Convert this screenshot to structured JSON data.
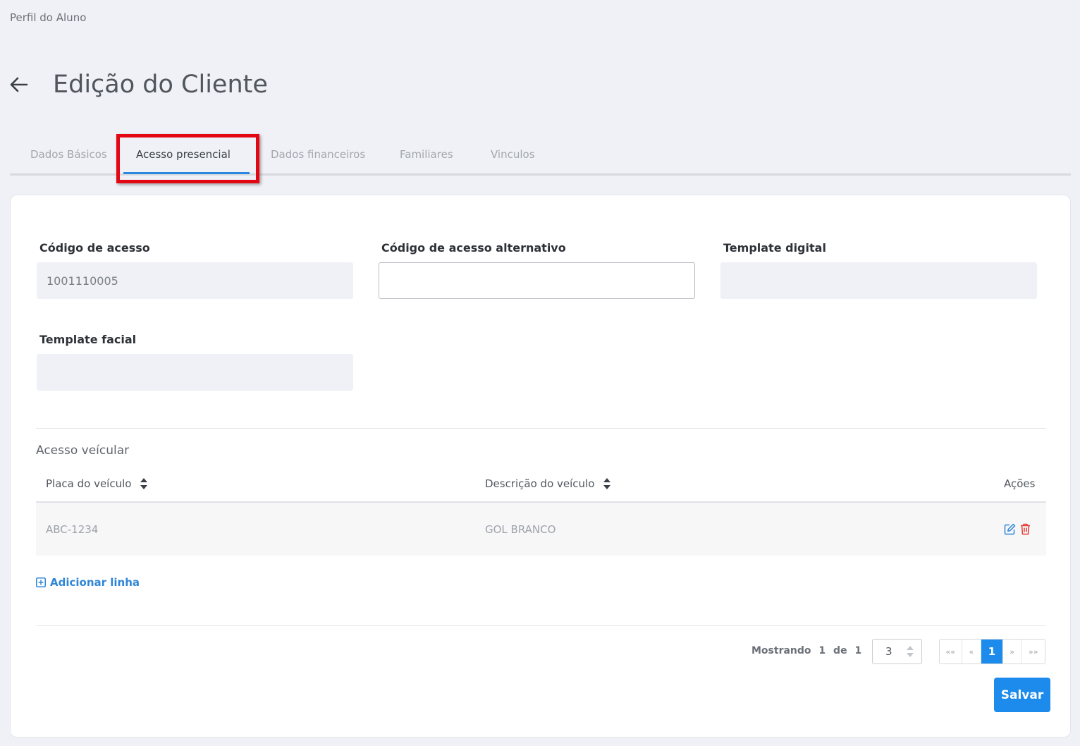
{
  "breadcrumb": "Perfil do Aluno",
  "header": {
    "title": "Edição do Cliente"
  },
  "tabs": [
    {
      "label": "Dados Básicos"
    },
    {
      "label": "Acesso presencial"
    },
    {
      "label": "Dados financeiros"
    },
    {
      "label": "Familiares"
    },
    {
      "label": "Vinculos"
    }
  ],
  "fields": {
    "access_code": {
      "label": "Código de acesso",
      "value": "1001110005"
    },
    "alt_access_code": {
      "label": "Código de acesso alternativo",
      "value": ""
    },
    "digital_template": {
      "label": "Template digital",
      "value": ""
    },
    "facial_template": {
      "label": "Template facial",
      "value": ""
    }
  },
  "vehicle_section": {
    "title": "Acesso veícular",
    "columns": [
      "Placa do veículo",
      "Descrição do veículo",
      "Ações"
    ],
    "rows": [
      {
        "plate": "ABC-1234",
        "description": "GOL BRANCO"
      }
    ],
    "add_row_label": "Adicionar linha"
  },
  "pagination": {
    "showing_label": "Mostrando",
    "current": "1",
    "of_label": "de",
    "total": "1",
    "page_size": "3",
    "buttons": [
      "««",
      "«",
      "1",
      "»",
      "»»"
    ]
  },
  "save_label": "Salvar",
  "colors": {
    "accent": "#1c8bec",
    "highlight": "#e30613",
    "delete": "#e53935"
  }
}
